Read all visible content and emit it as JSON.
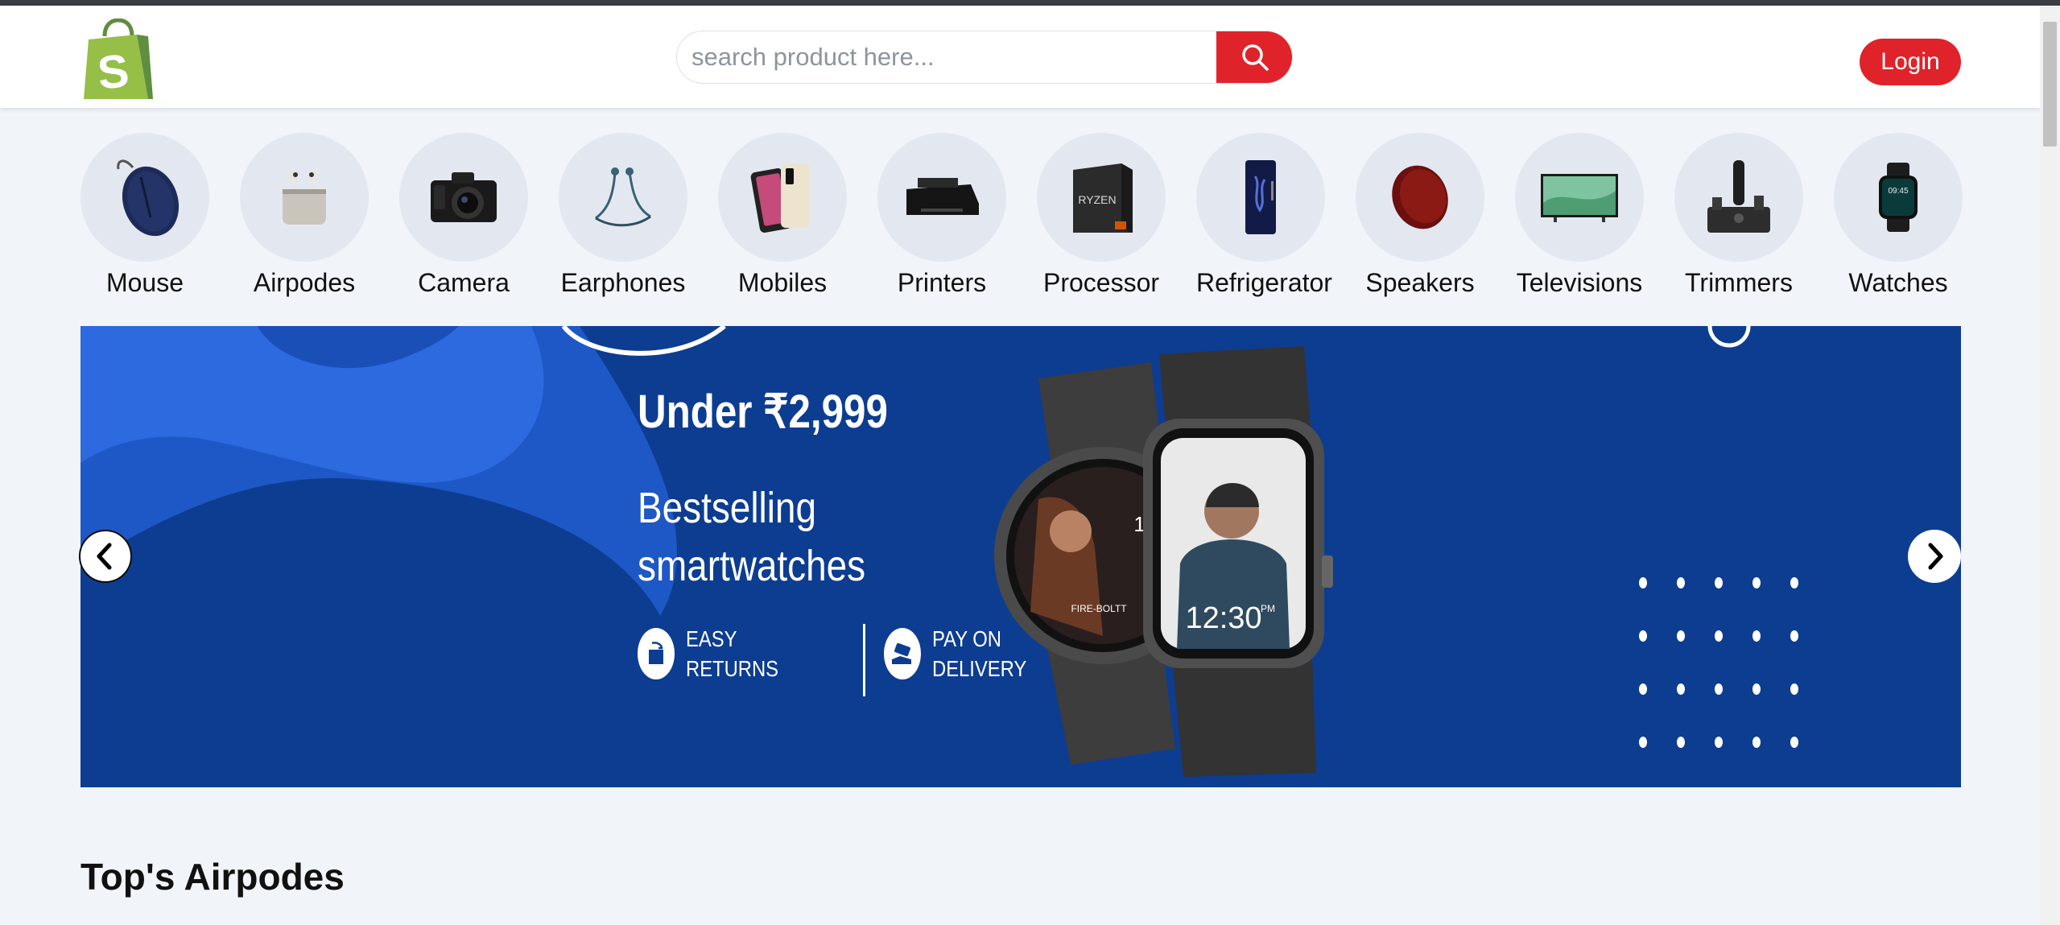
{
  "header": {
    "logo_icon": "shopify-bag-icon",
    "search": {
      "placeholder": "search product here...",
      "value": ""
    },
    "search_icon": "search-icon",
    "login_label": "Login"
  },
  "colors": {
    "accent": "#e0232a",
    "banner": "#0d3d91",
    "logo": "#95bf47"
  },
  "categories": [
    {
      "label": "Mouse",
      "icon": "mouse-icon"
    },
    {
      "label": "Airpodes",
      "icon": "airpods-icon"
    },
    {
      "label": "Camera",
      "icon": "camera-icon"
    },
    {
      "label": "Earphones",
      "icon": "earphones-icon"
    },
    {
      "label": "Mobiles",
      "icon": "mobile-icon"
    },
    {
      "label": "Printers",
      "icon": "printer-icon"
    },
    {
      "label": "Processor",
      "icon": "processor-icon"
    },
    {
      "label": "Refrigerator",
      "icon": "refrigerator-icon"
    },
    {
      "label": "Speakers",
      "icon": "speaker-icon"
    },
    {
      "label": "Televisions",
      "icon": "television-icon"
    },
    {
      "label": "Trimmers",
      "icon": "trimmer-icon"
    },
    {
      "label": "Watches",
      "icon": "watch-icon"
    }
  ],
  "banner": {
    "headline": "Under ₹2,999",
    "subheadline": "Bestselling smartwatches",
    "feature_1": "EASY RETURNS",
    "feature_2": "PAY ON DELIVERY",
    "watch_1_time": "11:32",
    "watch_2_time": "12:30",
    "watch_2_ampm": "PM",
    "watch_brand": "FIRE-BOLTT"
  },
  "carousel": {
    "prev_icon": "chevron-left-icon",
    "next_icon": "chevron-right-icon"
  },
  "section": {
    "title": "Top's Airpodes"
  }
}
